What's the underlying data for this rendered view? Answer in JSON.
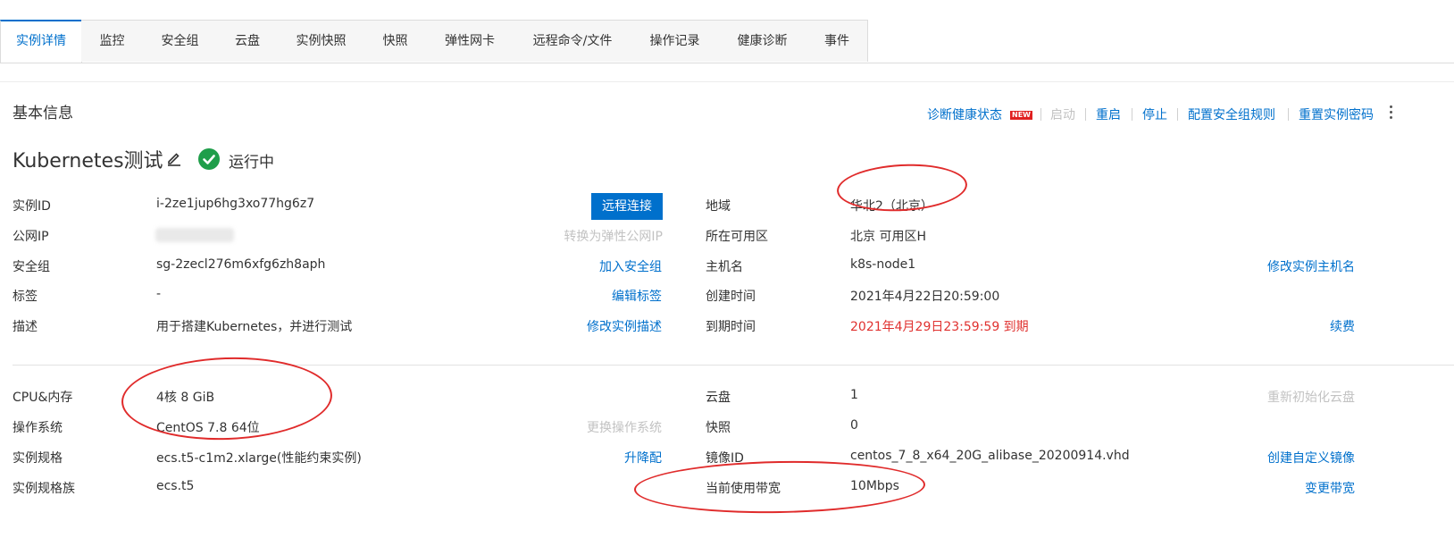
{
  "tabs": [
    {
      "label": "实例详情"
    },
    {
      "label": "监控"
    },
    {
      "label": "安全组"
    },
    {
      "label": "云盘"
    },
    {
      "label": "实例快照"
    },
    {
      "label": "快照"
    },
    {
      "label": "弹性网卡"
    },
    {
      "label": "远程命令/文件"
    },
    {
      "label": "操作记录"
    },
    {
      "label": "健康诊断"
    },
    {
      "label": "事件"
    }
  ],
  "section_title": "基本信息",
  "actions": {
    "diagnose": "诊断健康状态",
    "new_badge": "NEW",
    "start": "启动",
    "restart": "重启",
    "stop": "停止",
    "config_sg": "配置安全组规则",
    "reset_password": "重置实例密码"
  },
  "instance": {
    "name": "Kubernetes测试",
    "status": "运行中"
  },
  "left": {
    "instance_id": {
      "label": "实例ID",
      "value": "i-2ze1jup6hg3xo77hg6z7",
      "action": "远程连接"
    },
    "public_ip": {
      "label": "公网IP",
      "action": "转换为弹性公网IP"
    },
    "security_group": {
      "label": "安全组",
      "value": "sg-2zecl276m6xfg6zh8aph",
      "action": "加入安全组"
    },
    "tags": {
      "label": "标签",
      "value": "-",
      "action": "编辑标签"
    },
    "description": {
      "label": "描述",
      "value": "用于搭建Kubernetes，并进行测试",
      "action": "修改实例描述"
    },
    "cpu_mem": {
      "label": "CPU&内存",
      "value": "4核 8 GiB"
    },
    "os": {
      "label": "操作系统",
      "value": "CentOS 7.8 64位",
      "action": "更换操作系统"
    },
    "spec": {
      "label": "实例规格",
      "value": "ecs.t5-c1m2.xlarge(性能约束实例)",
      "action": "升降配"
    },
    "spec_family": {
      "label": "实例规格族",
      "value": "ecs.t5"
    }
  },
  "right": {
    "region": {
      "label": "地域",
      "value": "华北2（北京）"
    },
    "zone": {
      "label": "所在可用区",
      "value": "北京 可用区H"
    },
    "hostname": {
      "label": "主机名",
      "value": "k8s-node1",
      "action": "修改实例主机名"
    },
    "created": {
      "label": "创建时间",
      "value": "2021年4月22日20:59:00"
    },
    "expire": {
      "label": "到期时间",
      "value": "2021年4月29日23:59:59 到期",
      "action": "续费"
    },
    "disk": {
      "label": "云盘",
      "value": "1",
      "action": "重新初始化云盘"
    },
    "snapshot": {
      "label": "快照",
      "value": "0"
    },
    "image": {
      "label": "镜像ID",
      "value": "centos_7_8_x64_20G_alibase_20200914.vhd",
      "action": "创建自定义镜像"
    },
    "bandwidth": {
      "label": "当前使用带宽",
      "value": "10Mbps",
      "action": "变更带宽"
    }
  },
  "colors": {
    "accent": "#0070cc",
    "success": "#1f9e4a",
    "danger": "#e0312f",
    "annotation": "#e02b2b"
  },
  "icons": {
    "edit": "pencil-icon",
    "status": "check-circle-icon",
    "more": "more-vertical-icon"
  }
}
